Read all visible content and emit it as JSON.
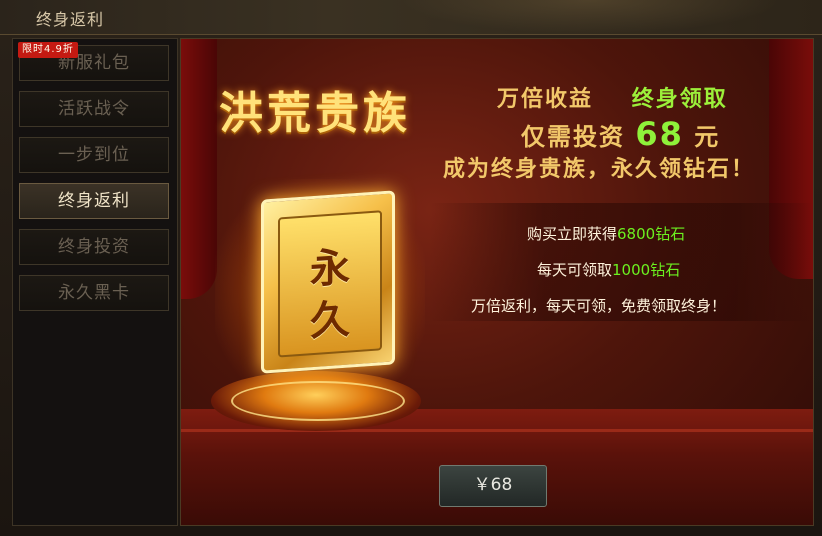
{
  "window": {
    "title": "终身返利"
  },
  "sidebar": {
    "items": [
      {
        "label": "新服礼包",
        "badge": "限时4.9折"
      },
      {
        "label": "活跃战令"
      },
      {
        "label": "一步到位"
      },
      {
        "label": "终身返利",
        "active": true
      },
      {
        "label": "终身投资"
      },
      {
        "label": "永久黑卡"
      }
    ]
  },
  "promo": {
    "title": "洪荒贵族",
    "line1_a": "万倍收益",
    "line1_b": "终身领取",
    "line2_a": "仅需投资",
    "line2_num": "68",
    "line2_b": "元",
    "line3": "成为终身贵族，永久领钻石！",
    "card_char_1": "永",
    "card_char_2": "久",
    "info1_a": "购买立即获得",
    "info1_hl": "6800钻石",
    "info2_a": "每天可领取",
    "info2_hl": "1000钻石",
    "info3": "万倍返利，每天可领，免费领取终身！",
    "buy_label": "￥68"
  },
  "colors": {
    "gold": "#f2c86a",
    "highlight_green": "#6cf020",
    "badge_red": "#c41a12"
  }
}
